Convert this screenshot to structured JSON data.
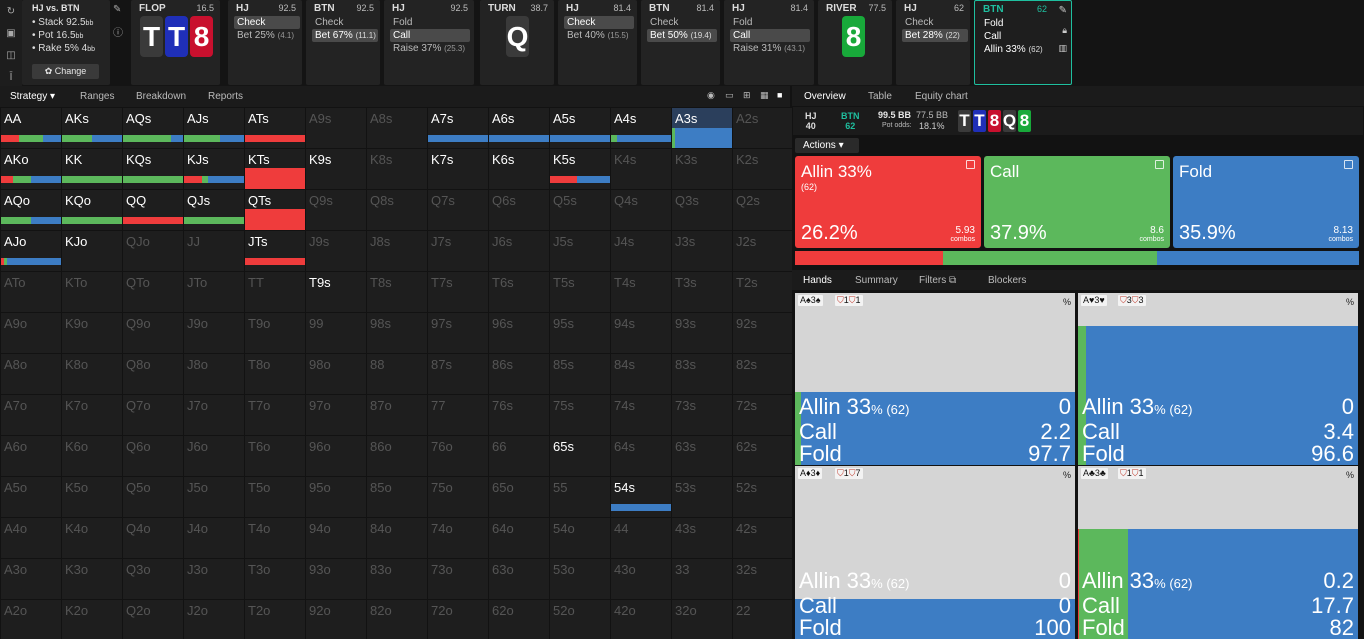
{
  "colors": {
    "allin": "#ef3c3c",
    "call": "#5cb85c",
    "fold": "#3d7dc4",
    "card_red": "#c8102e",
    "card_blue": "#1f2fb8",
    "card_gray": "#3a3a3a",
    "card_green": "#18a93a",
    "teal": "#1fbf9f"
  },
  "sidebar": {
    "icons": [
      "refresh-icon",
      "save-icon",
      "gamepad-icon",
      "text-icon"
    ]
  },
  "topbar": {
    "header": {
      "title": "HJ vs. BTN",
      "stack_label": "Stack 92.5",
      "stack_unit": "bb",
      "pot_label": "Pot 16.5",
      "pot_unit": "bb",
      "rake_label": "Rake 5% 4",
      "rake_unit": "bb",
      "change_button": "Change"
    },
    "flop": {
      "label": "FLOP",
      "pot": "16.5",
      "cards": [
        "T",
        "T",
        "8"
      ]
    },
    "b1": {
      "pos": "HJ",
      "stack": "92.5",
      "actions": [
        {
          "t": "Check",
          "s": "",
          "sel": true
        },
        {
          "t": "Bet 25%",
          "s": "(4.1)",
          "sel": false
        }
      ]
    },
    "b2": {
      "pos": "BTN",
      "stack": "92.5",
      "actions": [
        {
          "t": "Check",
          "s": "",
          "sel": false
        },
        {
          "t": "Bet 67%",
          "s": "(11.1)",
          "sel": true
        }
      ]
    },
    "b3": {
      "pos": "HJ",
      "stack": "92.5",
      "actions": [
        {
          "t": "Fold",
          "s": "",
          "sel": false
        },
        {
          "t": "Call",
          "s": "",
          "sel": true
        },
        {
          "t": "Raise 37%",
          "s": "(25.3)",
          "sel": false
        }
      ]
    },
    "turn": {
      "label": "TURN",
      "pot": "38.7",
      "card": "Q"
    },
    "b4": {
      "pos": "HJ",
      "stack": "81.4",
      "actions": [
        {
          "t": "Check",
          "s": "",
          "sel": true
        },
        {
          "t": "Bet 40%",
          "s": "(15.5)",
          "sel": false
        }
      ]
    },
    "b5": {
      "pos": "BTN",
      "stack": "81.4",
      "actions": [
        {
          "t": "Check",
          "s": "",
          "sel": false
        },
        {
          "t": "Bet 50%",
          "s": "(19.4)",
          "sel": true
        }
      ]
    },
    "b6": {
      "pos": "HJ",
      "stack": "81.4",
      "actions": [
        {
          "t": "Fold",
          "s": "",
          "sel": false
        },
        {
          "t": "Call",
          "s": "",
          "sel": true
        },
        {
          "t": "Raise 31%",
          "s": "(43.1)",
          "sel": false
        }
      ]
    },
    "river": {
      "label": "RIVER",
      "pot": "77.5",
      "card": "8"
    },
    "b7": {
      "pos": "HJ",
      "stack": "62",
      "actions": [
        {
          "t": "Check",
          "s": "",
          "sel": false
        },
        {
          "t": "Bet 28%",
          "s": "(22)",
          "sel": true
        }
      ]
    },
    "b8": {
      "pos": "BTN",
      "stack": "62",
      "actions": [
        {
          "t": "Fold",
          "s": ""
        },
        {
          "t": "Call",
          "s": ""
        },
        {
          "t": "Allin 33%",
          "s": "(62)"
        }
      ]
    }
  },
  "left_tabs": {
    "strategy": "Strategy",
    "ranges": "Ranges",
    "breakdown": "Breakdown",
    "reports": "Reports"
  },
  "grid": {
    "ranks": [
      "A",
      "K",
      "Q",
      "J",
      "T",
      "9",
      "8",
      "7",
      "6",
      "5",
      "4",
      "3",
      "2"
    ],
    "hot": {
      "AA": [
        0.3,
        0.4,
        0.3
      ],
      "AKs": [
        0,
        0.5,
        0.5
      ],
      "AQs": [
        0,
        0.8,
        0.2
      ],
      "AJs": [
        0,
        0.6,
        0.4
      ],
      "ATs": [
        1,
        0,
        0
      ],
      "A7s": [
        0,
        0,
        1
      ],
      "A6s": [
        0,
        0,
        1
      ],
      "A5s": [
        0,
        0,
        1
      ],
      "A4s": [
        0,
        0.1,
        0.9
      ],
      "A3s": [
        0,
        0.05,
        0.95
      ],
      "AKo": [
        0.2,
        0.3,
        0.5
      ],
      "KK": [
        0,
        1,
        0
      ],
      "KQs": [
        0,
        1,
        0
      ],
      "KJs": [
        0.3,
        0.1,
        0.6
      ],
      "KTs": [
        1,
        0,
        0
      ],
      "K9s": [
        0,
        0,
        0
      ],
      "K7s": [
        0,
        0,
        0
      ],
      "K6s": [
        0,
        0,
        0
      ],
      "K5s": [
        0.45,
        0,
        0.55
      ],
      "AQo": [
        0,
        0.5,
        0.5
      ],
      "KQo": [
        0,
        1,
        0
      ],
      "QQ": [
        1,
        0,
        0
      ],
      "QJs": [
        0,
        1,
        0
      ],
      "QTs": [
        1,
        0,
        0
      ],
      "AJo": [
        0.05,
        0.05,
        0.9
      ],
      "KJo": [
        0,
        0,
        0
      ],
      "JTs": [
        1,
        0,
        0
      ],
      "T9s": [
        0,
        0,
        0
      ],
      "65s": [
        0,
        0,
        0
      ],
      "54s": [
        0,
        0,
        1
      ]
    },
    "full": [
      "A3s",
      "KTs",
      "QTs"
    ]
  },
  "right_tabs": {
    "overview": "Overview",
    "table": "Table",
    "equity": "Equity chart"
  },
  "board": {
    "hj": "HJ",
    "hj_stack": "40",
    "btn": "BTN",
    "btn_stack": "62",
    "bb": "99.5 BB",
    "pot_bb": "77.5 BB",
    "pot_odds_label": "Pot odds:",
    "pot_odds": "18.1%",
    "cards": [
      "T",
      "T",
      "8",
      "Q",
      "8"
    ]
  },
  "actions_dropdown": "Actions",
  "summary": [
    {
      "name": "Allin 33%",
      "sub": "(62)",
      "pct": "26.2%",
      "combos": "5.93",
      "combos_label": "combos",
      "color": "allin"
    },
    {
      "name": "Call",
      "sub": "",
      "pct": "37.9%",
      "combos": "8.6",
      "combos_label": "combos",
      "color": "call"
    },
    {
      "name": "Fold",
      "sub": "",
      "pct": "35.9%",
      "combos": "8.13",
      "combos_label": "combos",
      "color": "fold"
    }
  ],
  "freq": [
    0.262,
    0.379,
    0.359
  ],
  "hand_tabs": {
    "hands": "Hands",
    "summary": "Summary",
    "filters": "Filters",
    "blockers": "Blockers"
  },
  "hands": [
    {
      "label": "A♠3♠",
      "blk1": "1",
      "blk2": "1",
      "pct": "%",
      "fill": [
        0,
        0.02,
        0.98
      ],
      "allin_label": "Allin 33",
      "allin_sub": "% (62)",
      "v": [
        "0",
        "2.2",
        "97.7"
      ]
    },
    {
      "label": "A♥3♥",
      "blk1": "3",
      "blk2": "3",
      "pct": "%",
      "fill": [
        0,
        0.03,
        0.97
      ],
      "allin_label": "Allin 33",
      "allin_sub": "% (62)",
      "v": [
        "0",
        "3.4",
        "96.6"
      ]
    },
    {
      "label": "A♦3♦",
      "blk1": "1",
      "blk2": "7",
      "pct": "%",
      "fill": [
        0,
        0,
        1
      ],
      "allin_label": "Allin 33",
      "allin_sub": "% (62)",
      "v": [
        "0",
        "0",
        "100"
      ]
    },
    {
      "label": "A♣3♣",
      "blk1": "1",
      "blk2": "1",
      "pct": "%",
      "fill": [
        0.002,
        0.177,
        0.82
      ],
      "allin_label": "Allin 33",
      "allin_sub": "% (62)",
      "v": [
        "0.2",
        "17.7",
        "82"
      ]
    }
  ],
  "labels": {
    "allin": "Allin 33",
    "call": "Call",
    "fold": "Fold"
  }
}
